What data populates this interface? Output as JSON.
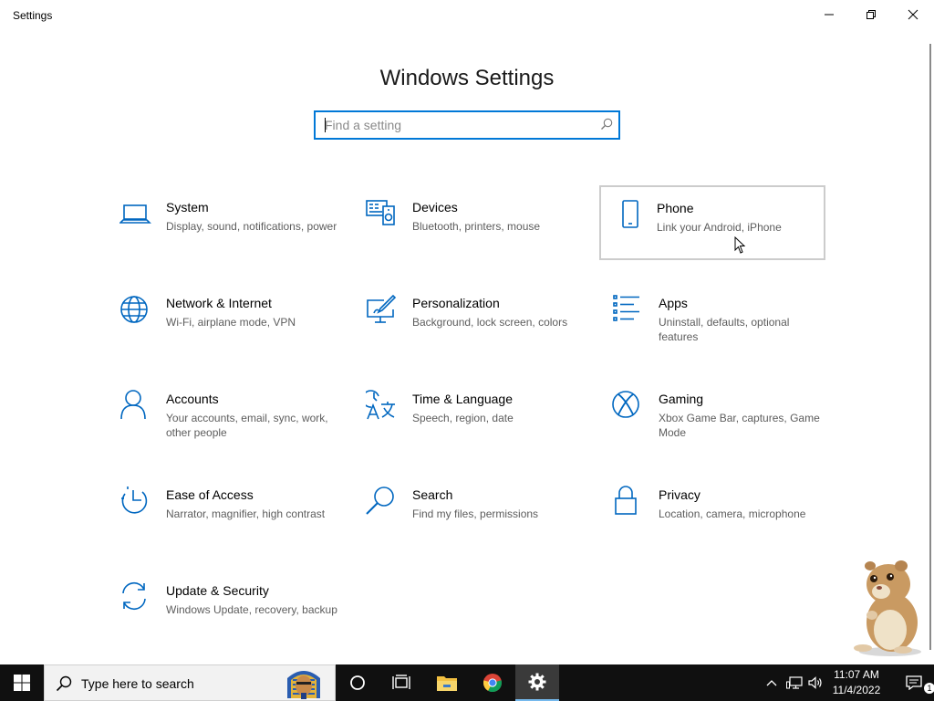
{
  "window": {
    "title": "Settings"
  },
  "header": {
    "title": "Windows Settings"
  },
  "search": {
    "placeholder": "Find a setting",
    "value": ""
  },
  "tiles": [
    {
      "title": "System",
      "desc": "Display, sound, notifications, power",
      "icon": "laptop-icon"
    },
    {
      "title": "Devices",
      "desc": "Bluetooth, printers, mouse",
      "icon": "devices-icon"
    },
    {
      "title": "Phone",
      "desc": "Link your Android, iPhone",
      "icon": "phone-icon"
    },
    {
      "title": "Network & Internet",
      "desc": "Wi-Fi, airplane mode, VPN",
      "icon": "globe-icon"
    },
    {
      "title": "Personalization",
      "desc": "Background, lock screen, colors",
      "icon": "paint-icon"
    },
    {
      "title": "Apps",
      "desc": "Uninstall, defaults, optional features",
      "icon": "apps-list-icon"
    },
    {
      "title": "Accounts",
      "desc": "Your accounts, email, sync, work, other people",
      "icon": "person-icon"
    },
    {
      "title": "Time & Language",
      "desc": "Speech, region, date",
      "icon": "time-language-icon"
    },
    {
      "title": "Gaming",
      "desc": "Xbox Game Bar, captures, Game Mode",
      "icon": "xbox-icon"
    },
    {
      "title": "Ease of Access",
      "desc": "Narrator, magnifier, high contrast",
      "icon": "ease-of-access-icon"
    },
    {
      "title": "Search",
      "desc": "Find my files, permissions",
      "icon": "search-icon"
    },
    {
      "title": "Privacy",
      "desc": "Location, camera, microphone",
      "icon": "lock-icon"
    },
    {
      "title": "Update & Security",
      "desc": "Windows Update, recovery, backup",
      "icon": "sync-icon"
    }
  ],
  "taskbar": {
    "search_text": "Type here to search",
    "time": "11:07 AM",
    "date": "11/4/2022",
    "notification_count": "1"
  },
  "colors": {
    "accent": "#0078d7",
    "taskbar": "#101010"
  }
}
